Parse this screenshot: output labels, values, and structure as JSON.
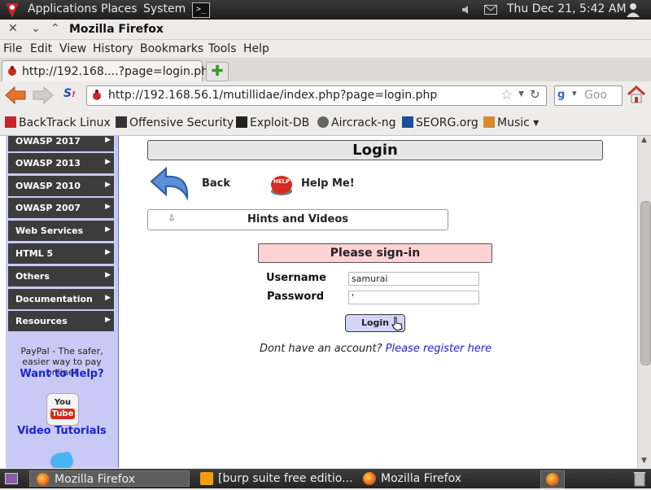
{
  "top_panel": {
    "menus": [
      "Applications",
      "Places",
      "System"
    ],
    "clock": "Thu Dec 21,  5:42 AM"
  },
  "window": {
    "title": "Mozilla Firefox"
  },
  "menubar": [
    "File",
    "Edit",
    "View",
    "History",
    "Bookmarks",
    "Tools",
    "Help"
  ],
  "tab": {
    "label": "http://192.168....?page=login.php",
    "new_tab_symbol": "✚"
  },
  "navbar": {
    "url": "http://192.168.56.1/mutillidae/index.php?page=login.php",
    "search_placeholder": "Goo"
  },
  "bookmarks": [
    {
      "label": "BackTrack Linux",
      "icon": "backtrack-icon"
    },
    {
      "label": "Offensive Security",
      "icon": "offsec-icon"
    },
    {
      "label": "Exploit-DB",
      "icon": "exploitdb-icon"
    },
    {
      "label": "Aircrack-ng",
      "icon": "aircrack-icon"
    },
    {
      "label": "SEORG.org",
      "icon": "seorg-icon"
    },
    {
      "label": "Music ▾",
      "icon": "folder-icon"
    }
  ],
  "sidebar": {
    "items": [
      "OWASP 2017",
      "OWASP 2013",
      "OWASP 2010",
      "OWASP 2007",
      "Web Services",
      "HTML 5",
      "Others",
      "Documentation",
      "Resources"
    ],
    "paypal_text": "PayPal - The safer, easier way to pay online!",
    "want_help": "Want to Help?",
    "video_tutorials": "Video Tutorials",
    "youtube_top": "You",
    "youtube_bottom": "Tube"
  },
  "page": {
    "title": "Login",
    "back_label": "Back",
    "help_label": "Help Me!",
    "help_badge": "HELP",
    "hints_label": "Hints and Videos",
    "signin_title": "Please sign-in",
    "username_label": "Username",
    "username_value": "samurai",
    "password_label": "Password",
    "password_value": "'",
    "login_button": "Login",
    "no_account_text": "Dont have an account?",
    "register_link": "Please register here"
  },
  "taskbar": [
    {
      "label": "Mozilla Firefox",
      "active": true
    },
    {
      "label": "[burp suite free editio...",
      "active": false
    },
    {
      "label": "Mozilla Firefox",
      "active": false
    }
  ],
  "colors": {
    "sidebar_bg": "#c9c9f5",
    "signin_bg": "#fdd2d2",
    "login_button_bg": "#d4d4f7",
    "link": "#1b22d8"
  }
}
